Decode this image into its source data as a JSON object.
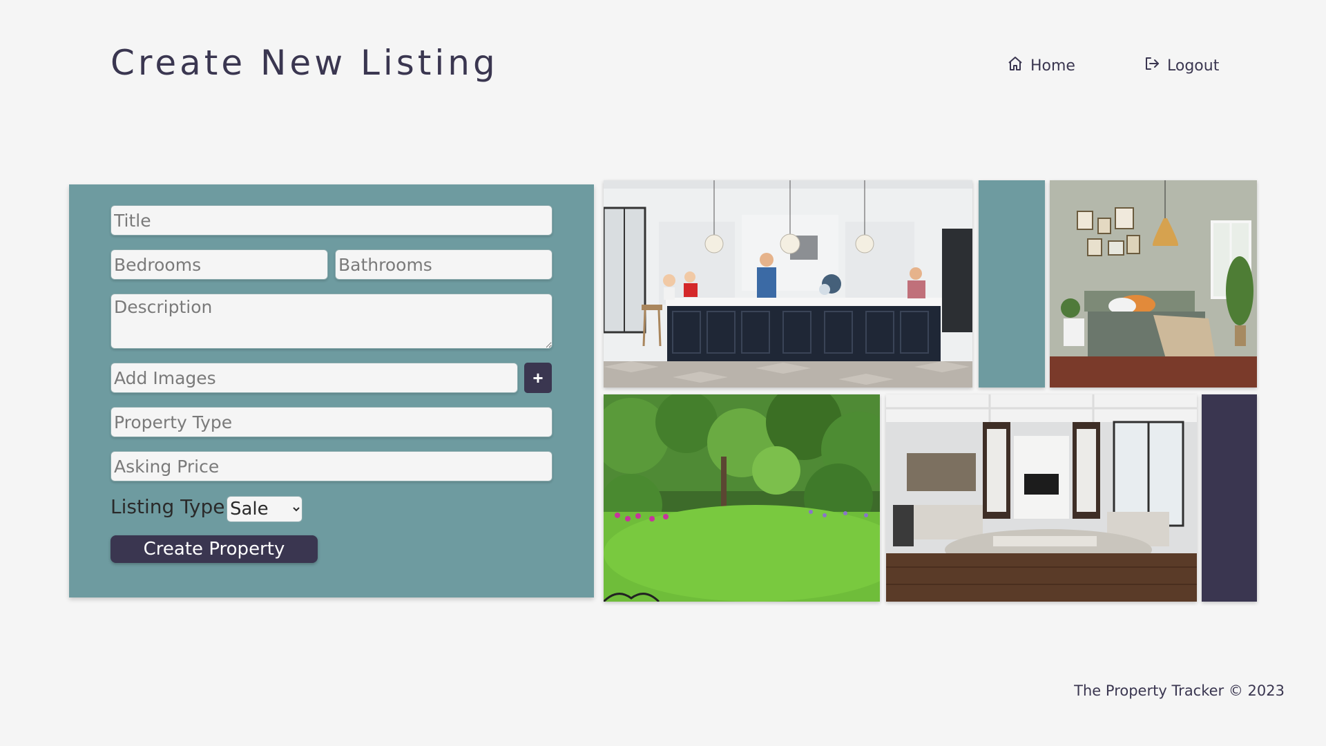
{
  "header": {
    "title": "Create New Listing",
    "nav": {
      "home_label": "Home",
      "logout_label": "Logout"
    }
  },
  "form": {
    "title_placeholder": "Title",
    "bedrooms_placeholder": "Bedrooms",
    "bathrooms_placeholder": "Bathrooms",
    "description_placeholder": "Description",
    "add_images_placeholder": "Add Images",
    "add_images_button": "+",
    "property_type_placeholder": "Property Type",
    "asking_price_placeholder": "Asking Price",
    "listing_type_label": "Listing Type:",
    "listing_type_selected": "Sale",
    "submit_label": "Create Property"
  },
  "gallery": {
    "images": [
      "kitchen photo",
      "bedroom photo",
      "garden photo",
      "living room photo"
    ]
  },
  "colors": {
    "background": "#f5f5f5",
    "panel_teal": "#6e9ba0",
    "dark_navy": "#3a3650"
  },
  "footer": {
    "text": "The Property Tracker © 2023"
  }
}
